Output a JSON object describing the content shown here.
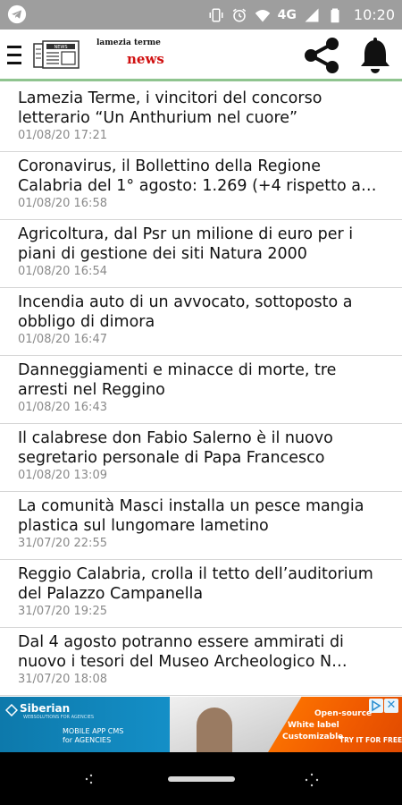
{
  "status_bar": {
    "time": "10:20",
    "network": "4G",
    "icons": [
      "telegram-icon",
      "vibrate-icon",
      "alarm-icon",
      "wifi-icon",
      "signal-icon",
      "battery-icon"
    ]
  },
  "app_bar": {
    "logo_line1": "lamezia terme",
    "logo_line2": "news",
    "icons": [
      "menu-icon",
      "newspaper-icon",
      "share-icon",
      "bell-icon"
    ],
    "divider_color": "#8fc48f",
    "brand_red": "#d01010"
  },
  "news": [
    {
      "title": "Lamezia Terme, i vincitori del concorso letterario “Un Anthurium nel cuore”",
      "date": "01/08/20 17:21"
    },
    {
      "title": "Coronavirus, il Bollettino della Regione Calabria del 1° agosto: 1.269 (+4 rispetto a ie…",
      "date": "01/08/20 16:58"
    },
    {
      "title": "Agricoltura, dal Psr un milione di euro per i piani di gestione dei siti Natura 2000",
      "date": "01/08/20 16:54"
    },
    {
      "title": "Incendia auto di un avvocato, sottoposto a obbligo di dimora",
      "date": "01/08/20 16:47"
    },
    {
      "title": "Danneggiamenti e minacce di morte, tre arresti nel Reggino",
      "date": "01/08/20 16:43"
    },
    {
      "title": "Il calabrese don Fabio Salerno è il nuovo segretario personale di Papa Francesco",
      "date": "01/08/20 13:09"
    },
    {
      "title": "La comunità Masci installa un pesce mangia plastica sul lungomare lametino",
      "date": "31/07/20 22:55"
    },
    {
      "title": "Reggio Calabria, crolla il tetto dell’auditorium del Palazzo Campanella",
      "date": "31/07/20 19:25"
    },
    {
      "title": "Dal 4 agosto potranno essere ammirati di nuovo i tesori del Museo Archeologico N…",
      "date": "31/07/20 18:08"
    }
  ],
  "ad": {
    "brand": "Siberian",
    "brand_sub": "WEBSOLUTIONS FOR AGENCIES",
    "cms_line1": "MOBILE APP CMS",
    "cms_line2": "for AGENCIES",
    "feature1": "Open-source",
    "feature2": "White label",
    "feature3": "Customizable",
    "cta": "TRY IT FOR FREE",
    "close": "✕"
  },
  "nav_bar": {
    "icons": [
      "back-icon",
      "home-pill",
      "recent-apps-icon"
    ]
  }
}
